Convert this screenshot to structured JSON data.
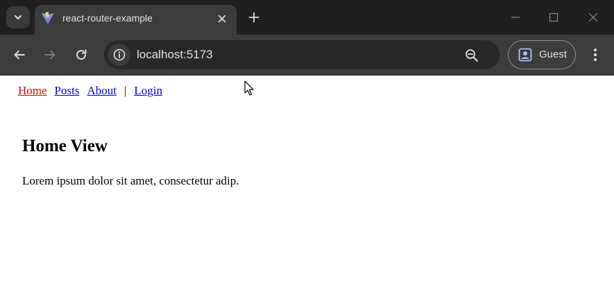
{
  "browser": {
    "tab": {
      "title": "react-router-example",
      "favicon": "vite-logo-icon"
    },
    "address_bar": {
      "url": "localhost:5173"
    },
    "profile": {
      "label": "Guest"
    }
  },
  "page": {
    "nav": {
      "links": [
        "Home",
        "Posts",
        "About",
        "Login"
      ],
      "separator": "|",
      "active": "Home"
    },
    "heading": "Home View",
    "body_text": "Lorem ipsum dolor sit amet, consectetur adip."
  },
  "colors": {
    "active_link": "#ee0000",
    "link": "#0000ee",
    "tabstrip_bg": "#1f1f1f",
    "toolbar_bg": "#3c3c3c"
  }
}
